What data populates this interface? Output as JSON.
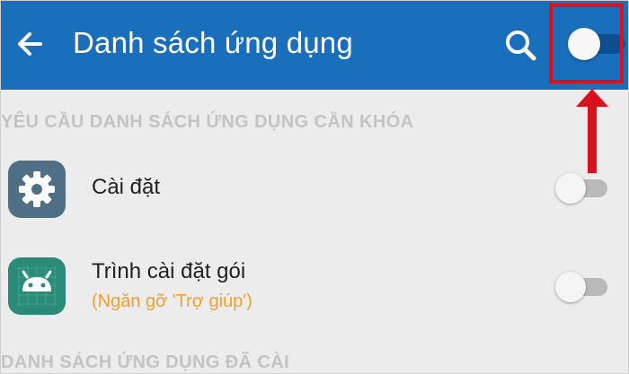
{
  "appbar": {
    "title": "Danh sách ứng dụng",
    "back_icon": "arrow-left-icon",
    "search_icon": "search-icon",
    "master_toggle_on": true,
    "color": "#1a6fbd"
  },
  "annotation": {
    "box_color": "#d7121c",
    "arrow_direction": "up"
  },
  "sections": [
    {
      "header": "YÊU CẦU DANH SÁCH ỨNG DỤNG CẦN KHÓA"
    },
    {
      "header": "DANH SÁCH ỨNG DỤNG ĐÃ CÀI"
    }
  ],
  "apps": [
    {
      "title": "Cài đặt",
      "subtitle": "",
      "icon": "settings-gear-icon",
      "icon_color": "#4f6f86",
      "toggle_on": false
    },
    {
      "title": "Trình cài đặt gói",
      "subtitle": "(Ngăn gỡ 'Trợ giúp')",
      "icon": "android-icon",
      "icon_color": "#2a8c78",
      "toggle_on": false
    }
  ]
}
